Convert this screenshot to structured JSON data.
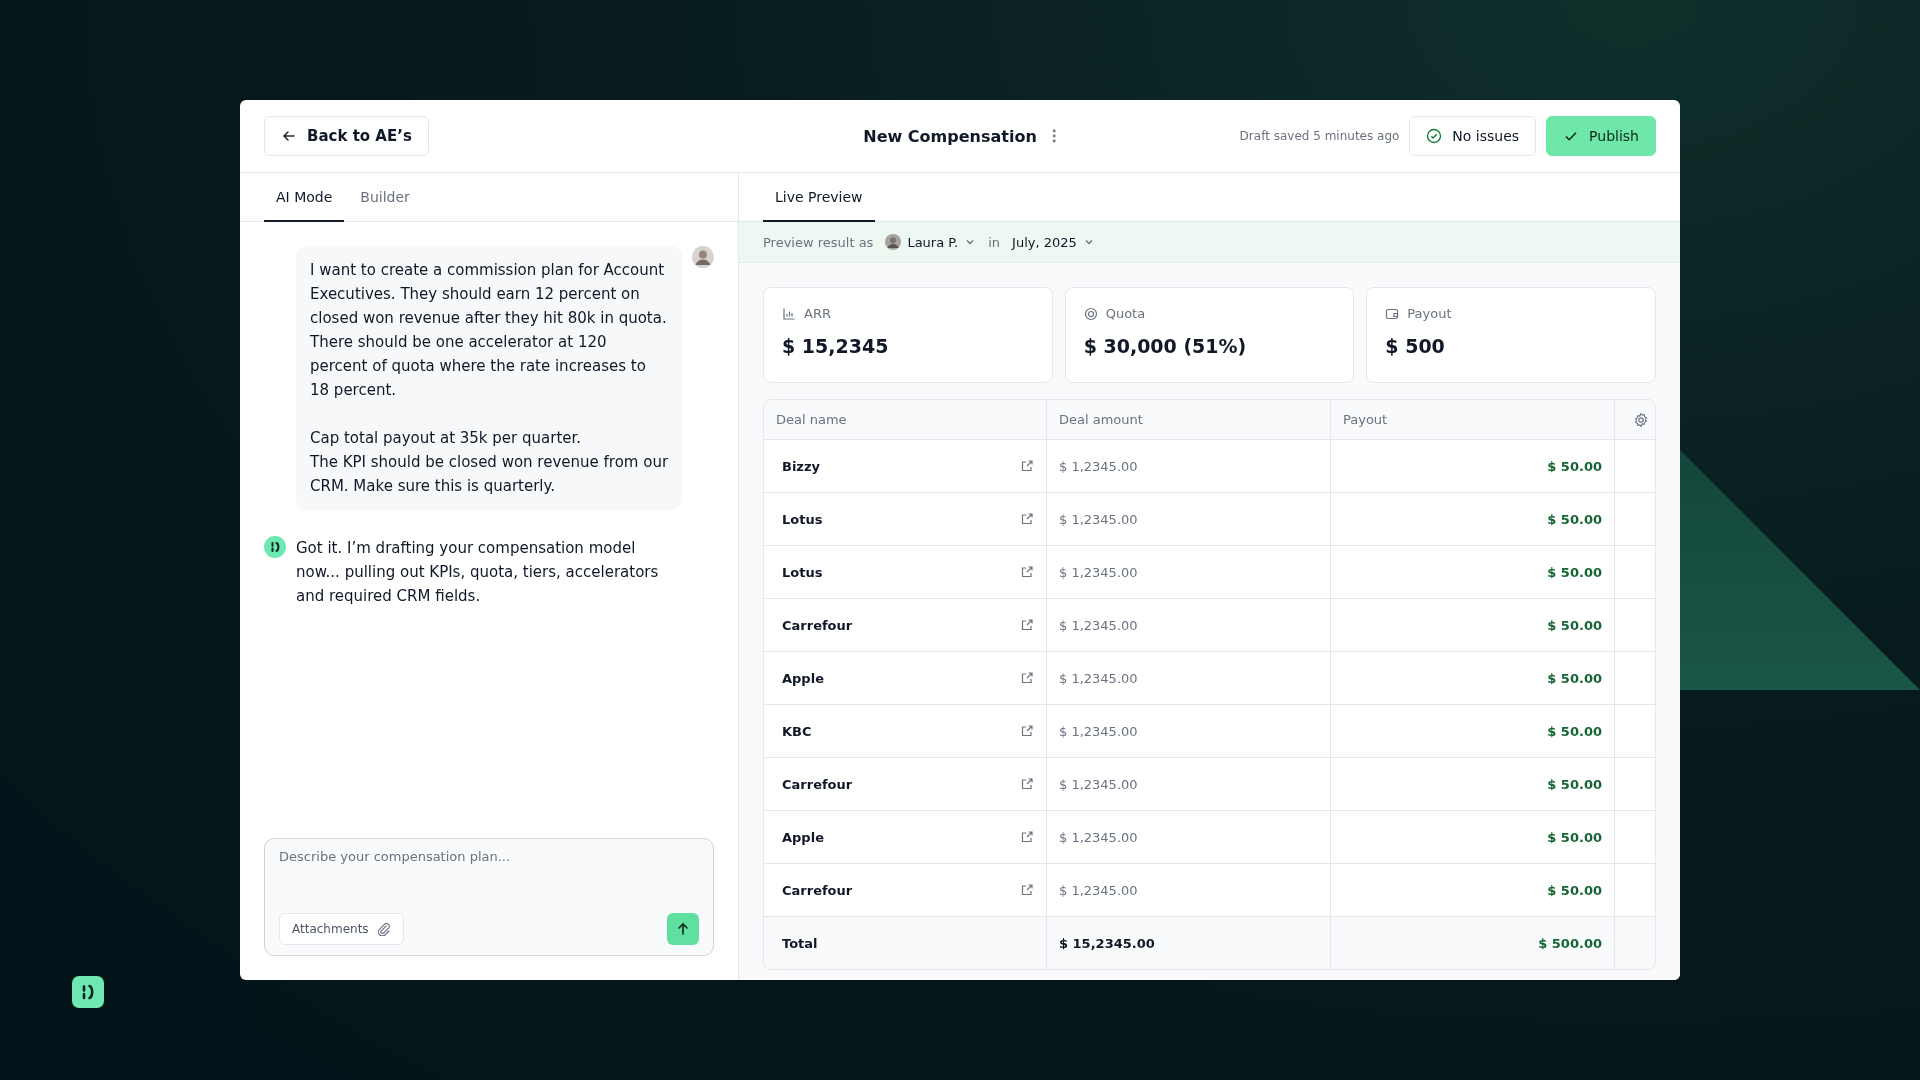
{
  "header": {
    "back_button": "Back to AE’s",
    "title": "New Compensation",
    "draft_status": "Draft saved 5 minutes ago",
    "issues_button": "No issues",
    "publish_button": "Publish"
  },
  "left_tabs": [
    {
      "label": "AI Mode",
      "selected": true
    },
    {
      "label": "Builder",
      "selected": false
    }
  ],
  "right_tabs": [
    {
      "label": "Live Preview",
      "selected": true
    }
  ],
  "messages": [
    {
      "kind": "user",
      "text": "I want to create a commission plan for Account Executives. They should earn 12 percent on closed won revenue after they hit 80k in quota. There should be one accelerator at 120 percent of quota where the rate increases to 18 percent.\n\nCap total payout at 35k per quarter.\nThe KPI should be closed won revenue from our CRM. Make sure this is quarterly."
    },
    {
      "kind": "assistant",
      "text": "Got it. I’m drafting your compensation model now... pulling out KPIs, quota, tiers, accelerators and required CRM fields."
    }
  ],
  "composer": {
    "placeholder": "Describe your compensation plan...",
    "attachments_button": "Attachments"
  },
  "preview_bar": {
    "label": "Preview result as",
    "person": "Laura P.",
    "connector": "in",
    "period": "July, 2025"
  },
  "cards": [
    {
      "kind": "arr",
      "label": "ARR",
      "value": "$ 15,2345"
    },
    {
      "kind": "quota",
      "label": "Quota",
      "value": "$ 30,000 (51%)"
    },
    {
      "kind": "payout",
      "label": "Payout",
      "value": "$ 500"
    }
  ],
  "table": {
    "columns": [
      "Deal name",
      "Deal amount",
      "Payout"
    ],
    "rows": [
      {
        "deal_name": "Bizzy",
        "deal_amount": "$ 1,2345.00",
        "payout": "$ 50.00"
      },
      {
        "deal_name": "Lotus",
        "deal_amount": "$ 1,2345.00",
        "payout": "$ 50.00"
      },
      {
        "deal_name": "Lotus",
        "deal_amount": "$ 1,2345.00",
        "payout": "$ 50.00"
      },
      {
        "deal_name": "Carrefour",
        "deal_amount": "$ 1,2345.00",
        "payout": "$ 50.00"
      },
      {
        "deal_name": "Apple",
        "deal_amount": "$ 1,2345.00",
        "payout": "$ 50.00"
      },
      {
        "deal_name": "KBC",
        "deal_amount": "$ 1,2345.00",
        "payout": "$ 50.00"
      },
      {
        "deal_name": "Carrefour",
        "deal_amount": "$ 1,2345.00",
        "payout": "$ 50.00"
      },
      {
        "deal_name": "Apple",
        "deal_amount": "$ 1,2345.00",
        "payout": "$ 50.00"
      },
      {
        "deal_name": "Carrefour",
        "deal_amount": "$ 1,2345.00",
        "payout": "$ 50.00"
      }
    ],
    "total": {
      "label": "Total",
      "deal_amount": "$ 15,2345.00",
      "payout": "$ 500.00"
    }
  }
}
